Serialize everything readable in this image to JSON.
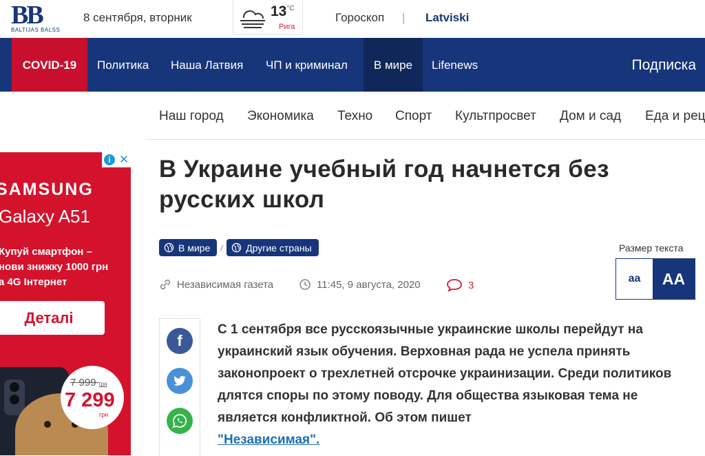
{
  "topbar": {
    "logo_text": "BB",
    "logo_sub": "BALTIJAS BALSS",
    "date": "8 сентября, вторник",
    "weather": {
      "temp": "13",
      "unit": "°C",
      "city": "Рига",
      "icon": "cloudy-weather-icon"
    },
    "horoscope": "Гороскоп",
    "separator": "|",
    "lang": "Latviski"
  },
  "nav": {
    "items": [
      "COVID-19",
      "Политика",
      "Наша Латвия",
      "ЧП и криминал",
      "В мире",
      "Lifenews"
    ],
    "active": "В мире",
    "subscribe": "Подписка"
  },
  "subnav": {
    "items": [
      "Наш город",
      "Экономика",
      "Техно",
      "Спорт",
      "Культпросвет",
      "Дом и сад",
      "Еда и рец"
    ]
  },
  "ad": {
    "brand": "SAMSUNG",
    "model": "Galaxy A51",
    "promo_lines": [
      "Купуй смартфон –",
      "нови знижку 1000 грн",
      "а 4G Інтернет"
    ],
    "button": "Деталі",
    "old_price": "7 999",
    "old_currency": "грн",
    "new_price": "7 299",
    "new_currency": "грн",
    "info_icon": "i",
    "close_icon": "✕"
  },
  "article": {
    "title": "В Украине учебный год начнется без русских школ",
    "tags": [
      "В мире",
      "Другие страны"
    ],
    "tag_separator": "/",
    "source": "Независимая газета",
    "datetime": "11:45, 9 августа, 2020",
    "comments": "3",
    "text_size_label": "Размер текста",
    "text_size_small": "aa",
    "text_size_big": "AA",
    "lead": "С 1 сентября все русскоязычные украинские школы перейдут на украинский язык обучения. Верховная рада не успела принять законопроект о трехлетней отсрочке украинизации. Среди политиков длятся споры по этому поводу. Для общества языковая тема не является конфликтной. Об этом пишет",
    "lead_link": "\"Независимая\".",
    "share": [
      "facebook-icon",
      "twitter-icon",
      "whatsapp-icon"
    ]
  },
  "colors": {
    "brand_blue": "#17357a",
    "covid_red": "#c8102e",
    "link_blue": "#1a6fb7"
  }
}
